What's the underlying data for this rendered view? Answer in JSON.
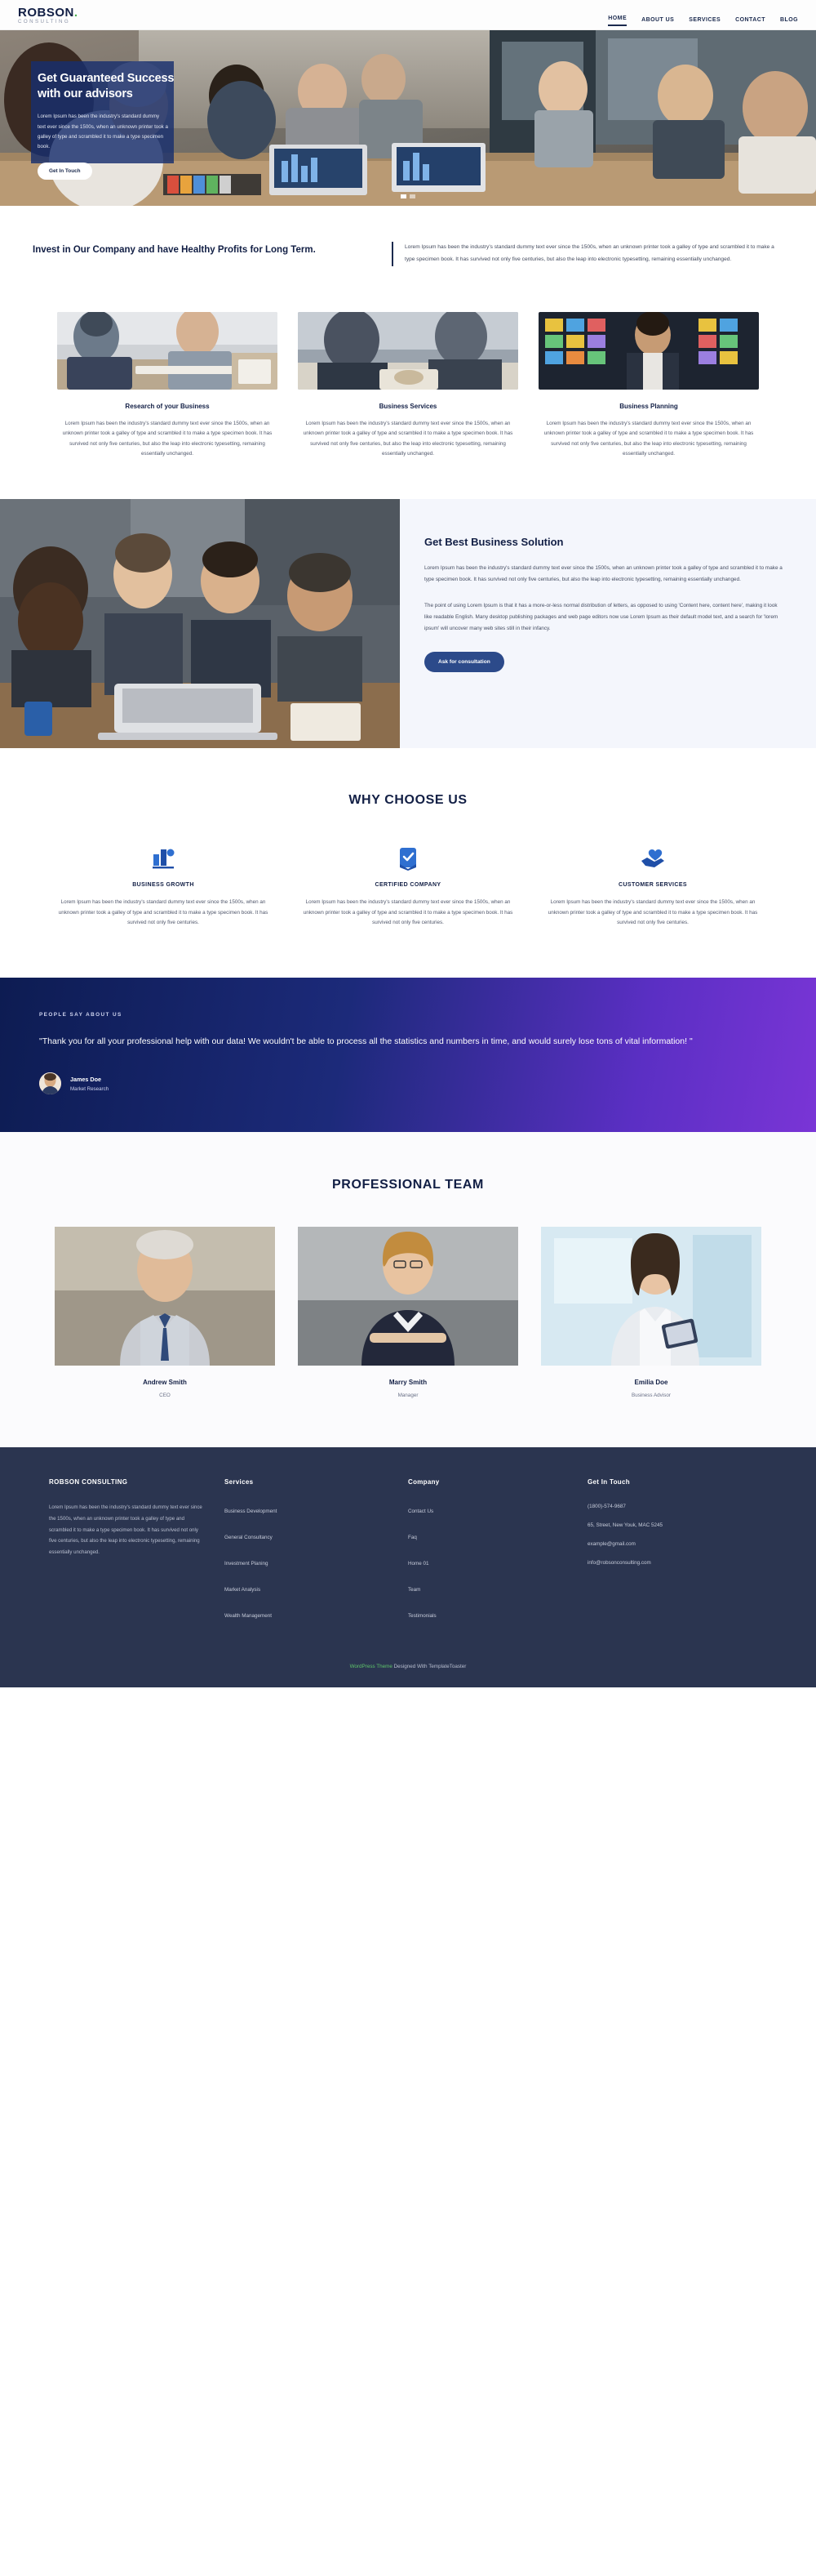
{
  "brand": {
    "logo_main": "ROBSON",
    "logo_dot": ".",
    "logo_sub": "CONSULTING",
    "accent": "#1b2a4e",
    "green": "#4caf50"
  },
  "nav": {
    "items": [
      {
        "label": "HOME",
        "active": true
      },
      {
        "label": "ABOUT US",
        "active": false
      },
      {
        "label": "SERVICES",
        "active": false
      },
      {
        "label": "CONTACT",
        "active": false
      },
      {
        "label": "BLOG",
        "active": false
      }
    ]
  },
  "hero": {
    "title_line1": "Get Guaranteed Success",
    "title_line2": "with our advisors",
    "description": "Lorem Ipsum has been the industry's standard dummy text ever since the 1500s, when an unknown printer took a galley of type and scrambled it to make a type specimen book.",
    "button": "Get In Touch",
    "slides": 2,
    "active_slide": 1
  },
  "intro": {
    "heading": "Invest in Our Company and have Healthy Profits for Long Term.",
    "body": "Lorem Ipsum has been the industry's standard dummy text ever since the 1500s, when an unknown printer took a galley of type and scrambled it to make a type specimen book. It has survived not only five centuries, but also the leap into electronic typesetting, remaining essentially unchanged."
  },
  "services": {
    "cards": [
      {
        "title": "Research of your Business",
        "text": "Lorem Ipsum has been the industry's standard dummy text ever since the 1500s, when an unknown printer took a galley of type and scrambled it to make a type specimen book. It has survived not only five centuries, but also the leap into electronic typesetting, remaining essentially unchanged."
      },
      {
        "title": "Business Services",
        "text": "Lorem Ipsum has been the industry's standard dummy text ever since the 1500s, when an unknown printer took a galley of type and scrambled it to make a type specimen book. It has survived not only five centuries, but also the leap into electronic typesetting, remaining essentially unchanged."
      },
      {
        "title": "Business Planning",
        "text": "Lorem Ipsum has been the industry's standard dummy text ever since the 1500s, when an unknown printer took a galley of type and scrambled it to make a type specimen book. It has survived not only five centuries, but also the leap into electronic typesetting, remaining essentially unchanged."
      }
    ]
  },
  "solution": {
    "title": "Get Best Business Solution",
    "para1": "Lorem Ipsum has been the industry's standard dummy text ever since the 1500s, when an unknown printer took a galley of type and scrambled it to make a type specimen book. It has survived not only five centuries, but also the leap into electronic typesetting, remaining essentially unchanged.",
    "para2": "The point of using Lorem Ipsum is that it has a more-or-less normal distribution of letters, as opposed to using 'Content here, content here', making it look like readable English. Many desktop publishing packages and web page editors now use Lorem Ipsum as their default model text, and a search for 'lorem ipsum' will uncover many web sites still in their infancy.",
    "button": "Ask for consultation"
  },
  "why": {
    "title": "WHY CHOOSE US",
    "items": [
      {
        "icon": "bar-chart-icon",
        "name": "BUSINESS GROWTH",
        "text": "Lorem Ipsum has been the industry's standard dummy text ever since the 1500s, when an unknown printer took a galley of type and scrambled it to make a type specimen book. It has survived not only five centuries."
      },
      {
        "icon": "certificate-check-icon",
        "name": "CERTIFIED COMPANY",
        "text": "Lorem Ipsum has been the industry's standard dummy text ever since the 1500s, when an unknown printer took a galley of type and scrambled it to make a type specimen book. It has survived not only five centuries."
      },
      {
        "icon": "handshake-heart-icon",
        "name": "CUSTOMER SERVICES",
        "text": "Lorem Ipsum has been the industry's standard dummy text ever since the 1500s, when an unknown printer took a galley of type and scrambled it to make a type specimen book. It has survived not only five centuries."
      }
    ]
  },
  "testimonial": {
    "label": "PEOPLE SAY ABOUT US",
    "quote": "\"Thank you for all your professional help with our data! We wouldn't be able to process all the statistics and numbers in time, and would surely lose tons of vital information! \"",
    "name": "James Doe",
    "role": "Market Research"
  },
  "team": {
    "title": "PROFESSIONAL TEAM",
    "members": [
      {
        "name": "Andrew Smith",
        "role": "CEO"
      },
      {
        "name": "Marry Smith",
        "role": "Manager"
      },
      {
        "name": "Emilia Doe",
        "role": "Business Advisor"
      }
    ]
  },
  "footer": {
    "brand": "ROBSON CONSULTING",
    "about": "Lorem Ipsum has been the industry's standard dummy text ever since the 1500s, when an unknown printer took a galley of type and scrambled it to make a type specimen book. It has survived not only five centuries, but also the leap into electronic typesetting, remaining essentially unchanged.",
    "services_head": "Services",
    "services": [
      "Business Development",
      "General Consultancy",
      "Investment Planing",
      "Market Analysis",
      "Wealth Management"
    ],
    "company_head": "Company",
    "company": [
      "Contact Us",
      "Faq",
      "Home 01",
      "Team",
      "Testimonials"
    ],
    "touch_head": "Get In Touch",
    "phone": "(1800)-574-9687",
    "address": "65, Street, New Youk, MAC 5245",
    "email1": "example@gmail.com",
    "email2": "info@robsonconsulting.com",
    "bottom_prefix": "WordPress Theme",
    "bottom_suffix": " Designed With TemplateToaster"
  }
}
